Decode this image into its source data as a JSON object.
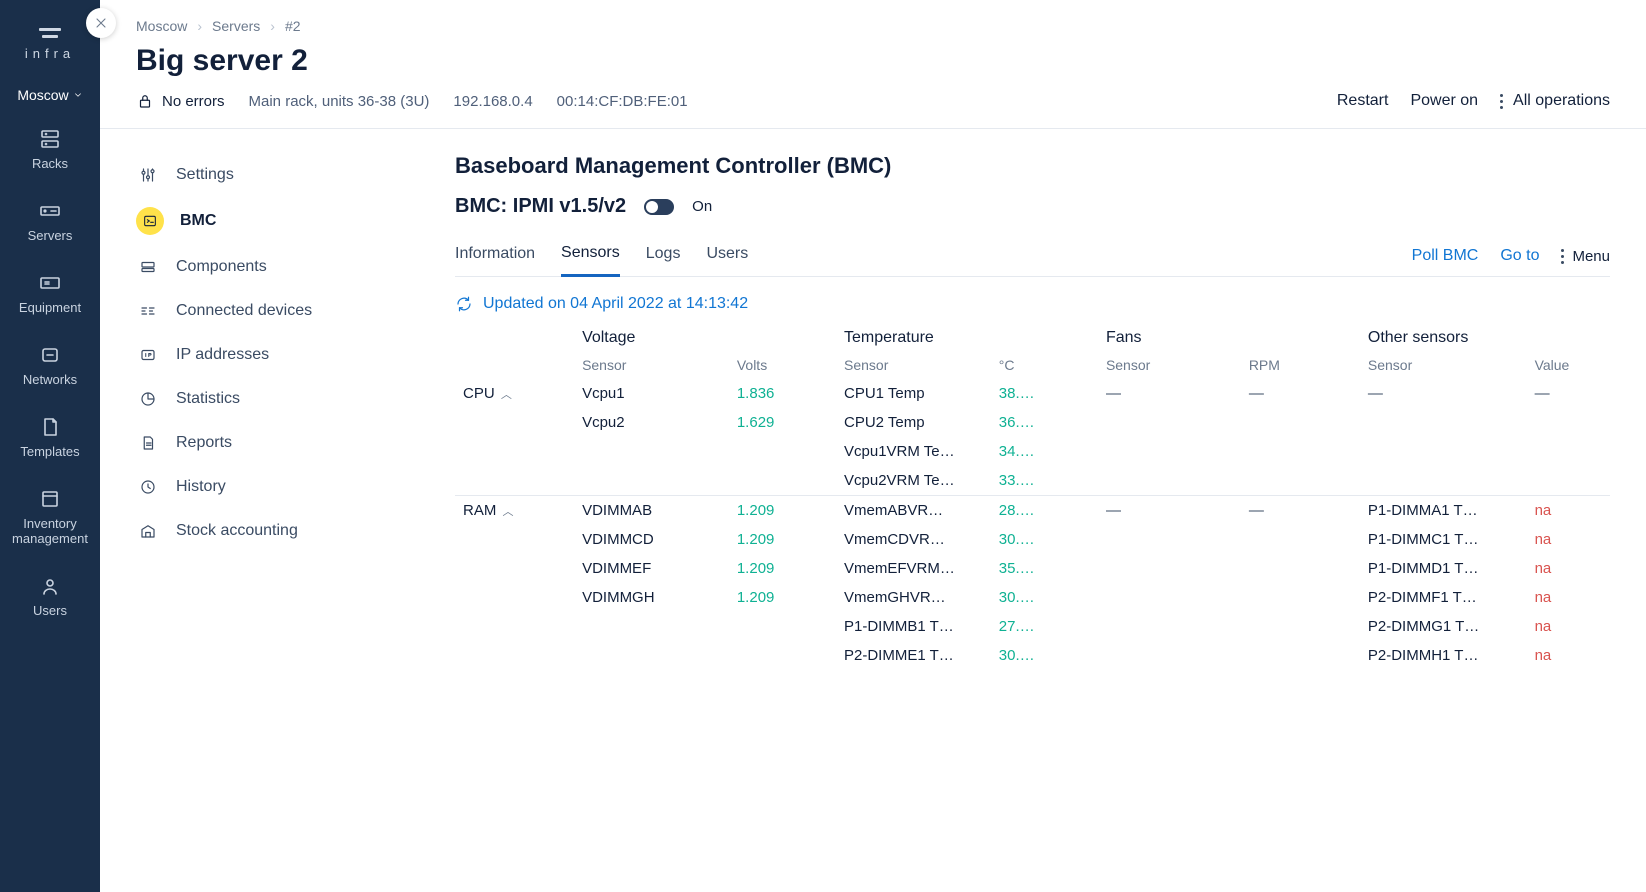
{
  "brand": "infra",
  "location": "Moscow",
  "rail": [
    {
      "id": "racks",
      "label": "Racks"
    },
    {
      "id": "servers",
      "label": "Servers"
    },
    {
      "id": "equipment",
      "label": "Equipment"
    },
    {
      "id": "networks",
      "label": "Networks"
    },
    {
      "id": "templates",
      "label": "Templates"
    },
    {
      "id": "inventory",
      "label": "Inventory management"
    },
    {
      "id": "users",
      "label": "Users"
    }
  ],
  "breadcrumb": [
    "Moscow",
    "Servers",
    "#2"
  ],
  "page_title": "Big server 2",
  "meta": {
    "status": "No errors",
    "rack": "Main rack, units 36-38 (3U)",
    "ip": "192.168.0.4",
    "mac": "00:14:CF:DB:FE:01"
  },
  "top_actions": {
    "restart": "Restart",
    "power": "Power on",
    "all": "All operations"
  },
  "side_menu": [
    {
      "id": "settings",
      "label": "Settings"
    },
    {
      "id": "bmc",
      "label": "BMC"
    },
    {
      "id": "components",
      "label": "Components"
    },
    {
      "id": "connected",
      "label": "Connected devices"
    },
    {
      "id": "ip",
      "label": "IP addresses"
    },
    {
      "id": "stats",
      "label": "Statistics"
    },
    {
      "id": "reports",
      "label": "Reports"
    },
    {
      "id": "history",
      "label": "History"
    },
    {
      "id": "stock",
      "label": "Stock accounting"
    }
  ],
  "bmc": {
    "heading": "Baseboard Management Controller (BMC)",
    "device": "BMC: IPMI v1.5/v2",
    "state": "On",
    "tabs": [
      "Information",
      "Sensors",
      "Logs",
      "Users"
    ],
    "active_tab": "Sensors",
    "tab_actions": {
      "poll": "Poll BMC",
      "goto": "Go to",
      "menu": "Menu"
    },
    "updated": "Updated on 04 April 2022 at 14:13:42"
  },
  "sensor_headers": {
    "voltage": {
      "title": "Voltage",
      "c1": "Sensor",
      "c2": "Volts"
    },
    "temperature": {
      "title": "Temperature",
      "c1": "Sensor",
      "c2": "°C"
    },
    "fans": {
      "title": "Fans",
      "c1": "Sensor",
      "c2": "RPM"
    },
    "other": {
      "title": "Other sensors",
      "c1": "Sensor",
      "c2": "Value"
    }
  },
  "groups": [
    {
      "name": "CPU",
      "voltage": [
        [
          "Vcpu1",
          "1.836"
        ],
        [
          "Vcpu2",
          "1.629"
        ]
      ],
      "temperature": [
        [
          "CPU1 Temp",
          "38.…"
        ],
        [
          "CPU2 Temp",
          "36.…"
        ],
        [
          "Vcpu1VRM Te…",
          "34.…"
        ],
        [
          "Vcpu2VRM Te…",
          "33.…"
        ]
      ],
      "fans": [
        [
          "—",
          "—"
        ]
      ],
      "other": [
        [
          "—",
          "—"
        ]
      ]
    },
    {
      "name": "RAM",
      "voltage": [
        [
          "VDIMMAB",
          "1.209"
        ],
        [
          "VDIMMCD",
          "1.209"
        ],
        [
          "VDIMMEF",
          "1.209"
        ],
        [
          "VDIMMGH",
          "1.209"
        ]
      ],
      "temperature": [
        [
          "VmemABVR…",
          "28.…"
        ],
        [
          "VmemCDVR…",
          "30.…"
        ],
        [
          "VmemEFVRM…",
          "35.…"
        ],
        [
          "VmemGHVR…",
          "30.…"
        ],
        [
          "P1-DIMMB1 T…",
          "27.…"
        ],
        [
          "P2-DIMME1 T…",
          "30.…"
        ]
      ],
      "fans": [
        [
          "—",
          "—"
        ]
      ],
      "other": [
        [
          "P1-DIMMA1 T…",
          "na"
        ],
        [
          "P1-DIMMC1 T…",
          "na"
        ],
        [
          "P1-DIMMD1 T…",
          "na"
        ],
        [
          "P2-DIMMF1 T…",
          "na"
        ],
        [
          "P2-DIMMG1 T…",
          "na"
        ],
        [
          "P2-DIMMH1 T…",
          "na"
        ]
      ]
    }
  ]
}
